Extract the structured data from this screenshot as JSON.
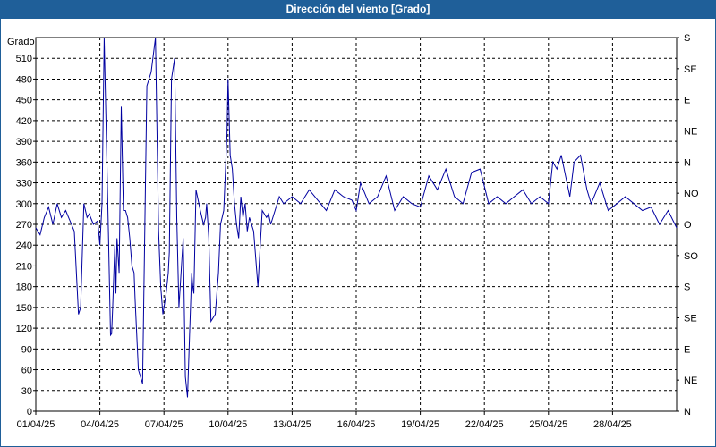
{
  "window": {
    "title": "Dirección del viento [Grado]"
  },
  "chart_data": {
    "type": "line",
    "title": "Dirección del viento [Grado]",
    "ylabel": "Grado",
    "ylim": [
      0,
      540
    ],
    "yticks": [
      0,
      30,
      60,
      90,
      120,
      150,
      180,
      210,
      240,
      270,
      300,
      330,
      360,
      390,
      420,
      450,
      480,
      510
    ],
    "y2_ticks": [
      {
        "value": 0,
        "label": "N"
      },
      {
        "value": 45,
        "label": "NE"
      },
      {
        "value": 90,
        "label": "E"
      },
      {
        "value": 135,
        "label": "SE"
      },
      {
        "value": 180,
        "label": "S"
      },
      {
        "value": 225,
        "label": "SO"
      },
      {
        "value": 270,
        "label": "O"
      },
      {
        "value": 315,
        "label": "NO"
      },
      {
        "value": 360,
        "label": "N"
      },
      {
        "value": 405,
        "label": "NE"
      },
      {
        "value": 450,
        "label": "E"
      },
      {
        "value": 495,
        "label": "SE"
      },
      {
        "value": 540,
        "label": "S"
      }
    ],
    "x_start": "01/04/25",
    "x_end": "01/05/25",
    "x_day_range": [
      0,
      30
    ],
    "xtick_labels": [
      "01/04/25",
      "04/04/25",
      "07/04/25",
      "10/04/25",
      "13/04/25",
      "16/04/25",
      "19/04/25",
      "22/04/25",
      "25/04/25",
      "28/04/25"
    ],
    "xtick_days": [
      0,
      3,
      6,
      9,
      12,
      15,
      18,
      21,
      24,
      27
    ],
    "grid": true,
    "series": [
      {
        "color": "#0000a0",
        "x_days": [
          0.0,
          0.2,
          0.4,
          0.6,
          0.8,
          1.0,
          1.2,
          1.4,
          1.6,
          1.8,
          2.0,
          2.1,
          2.25,
          2.4,
          2.5,
          2.7,
          2.9,
          3.0,
          3.1,
          3.2,
          3.4,
          3.5,
          3.55,
          3.6,
          3.7,
          3.75,
          3.8,
          3.9,
          4.0,
          4.1,
          4.2,
          4.3,
          4.4,
          4.5,
          4.6,
          4.65,
          4.8,
          5.0,
          5.2,
          5.4,
          5.6,
          5.75,
          5.85,
          5.95,
          6.0,
          6.1,
          6.2,
          6.25,
          6.35,
          6.5,
          6.6,
          6.7,
          6.8,
          6.9,
          7.0,
          7.1,
          7.2,
          7.3,
          7.35,
          7.4,
          7.5,
          7.7,
          7.85,
          7.95,
          8.0,
          8.1,
          8.2,
          8.4,
          8.55,
          8.65,
          8.8,
          8.95,
          9.0,
          9.1,
          9.2,
          9.3,
          9.4,
          9.5,
          9.6,
          9.7,
          9.8,
          9.9,
          10.0,
          10.2,
          10.4,
          10.6,
          10.8,
          10.9,
          11.0,
          11.2,
          11.4,
          11.6,
          12.0,
          12.4,
          12.8,
          13.2,
          13.6,
          14.0,
          14.4,
          14.8,
          15.0,
          15.2,
          15.6,
          16.0,
          16.4,
          16.8,
          17.2,
          17.6,
          18.0,
          18.4,
          18.8,
          19.2,
          19.6,
          20.0,
          20.4,
          20.8,
          21.2,
          21.6,
          22.0,
          22.4,
          22.8,
          23.2,
          23.6,
          24.0,
          24.2,
          24.4,
          24.6,
          24.8,
          25.0,
          25.2,
          25.5,
          25.8,
          26.0,
          26.4,
          26.8,
          27.2,
          27.6,
          28.0,
          28.4,
          28.8,
          29.2,
          29.6,
          30.0
        ],
        "values": [
          265,
          255,
          280,
          295,
          270,
          300,
          280,
          290,
          275,
          260,
          140,
          150,
          300,
          280,
          285,
          270,
          275,
          240,
          300,
          540,
          260,
          110,
          112,
          150,
          240,
          170,
          250,
          200,
          440,
          290,
          290,
          280,
          250,
          210,
          200,
          160,
          60,
          40,
          470,
          490,
          540,
          260,
          180,
          140,
          150,
          170,
          200,
          230,
          480,
          510,
          280,
          150,
          200,
          250,
          50,
          20,
          110,
          200,
          180,
          170,
          320,
          290,
          270,
          280,
          300,
          250,
          130,
          140,
          200,
          270,
          290,
          400,
          480,
          370,
          350,
          300,
          270,
          250,
          310,
          280,
          300,
          260,
          280,
          260,
          180,
          290,
          280,
          285,
          270,
          290,
          310,
          300,
          310,
          300,
          320,
          305,
          290,
          320,
          310,
          305,
          290,
          330,
          300,
          310,
          340,
          290,
          310,
          300,
          295,
          340,
          320,
          350,
          310,
          300,
          345,
          350,
          300,
          310,
          300,
          310,
          320,
          300,
          310,
          300,
          360,
          350,
          370,
          340,
          310,
          360,
          370,
          320,
          300,
          330,
          290,
          300,
          310,
          300,
          290,
          295,
          270,
          290,
          265,
          250
        ]
      }
    ]
  }
}
